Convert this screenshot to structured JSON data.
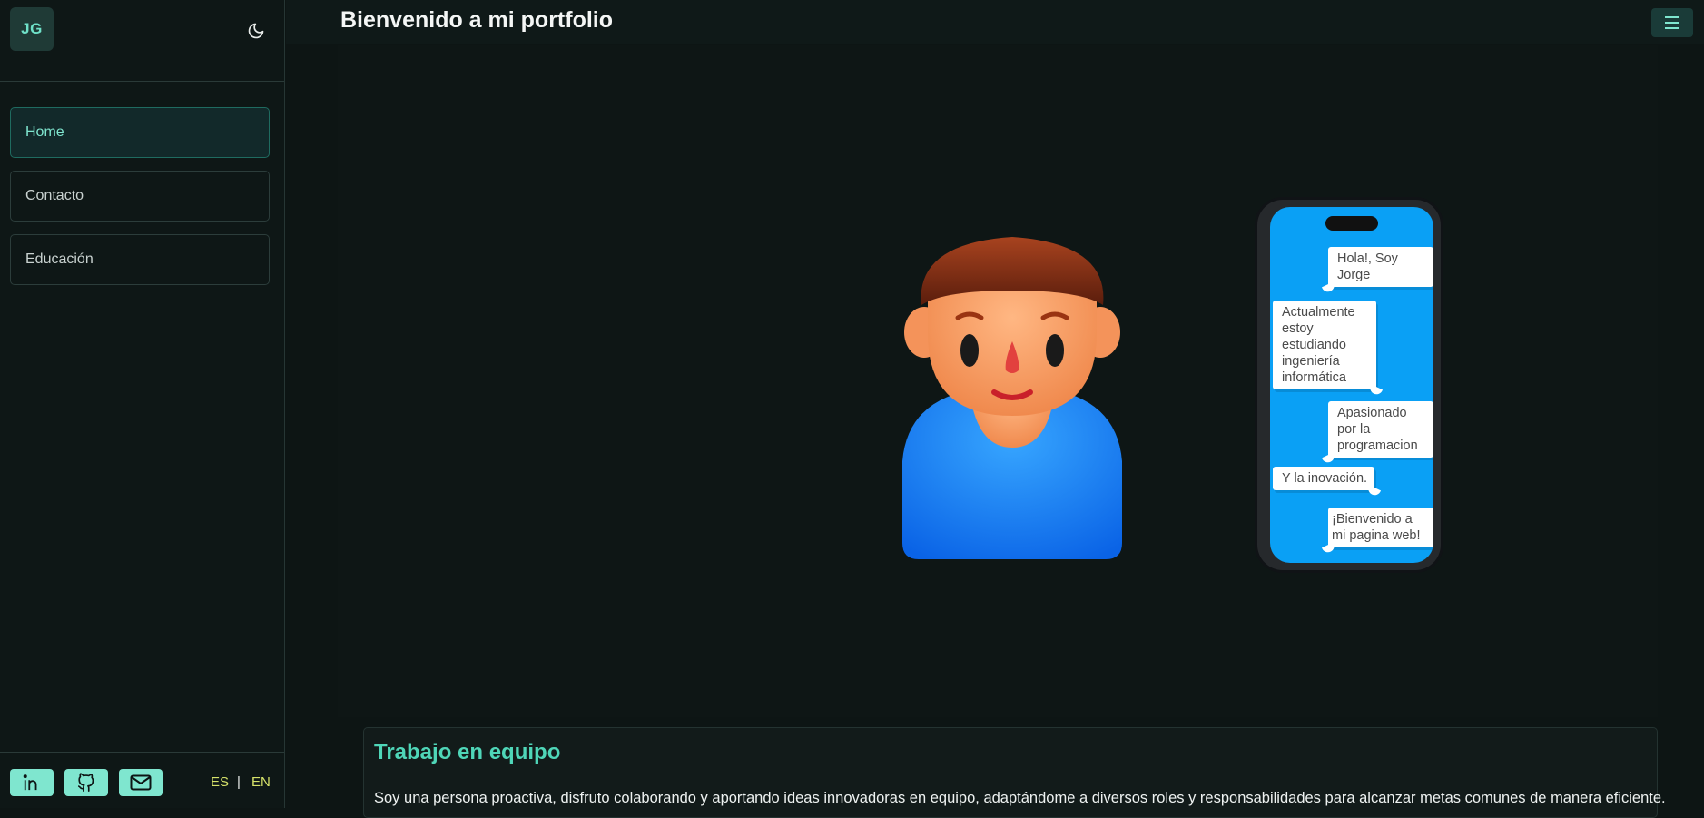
{
  "sidebar": {
    "logo": "JG",
    "nav": [
      {
        "label": "Home",
        "active": true
      },
      {
        "label": "Contacto",
        "active": false
      },
      {
        "label": "Educación",
        "active": false
      }
    ],
    "social": [
      "linkedin-icon",
      "github-icon",
      "mail-icon"
    ],
    "lang": {
      "es": "ES",
      "sep": "|",
      "en": "EN"
    }
  },
  "header": {
    "title": "Bienvenido a mi portfolio"
  },
  "phone": {
    "messages": [
      "Hola!, Soy Jorge",
      "Actualmente estoy estudiando ingeniería informática",
      "Apasionado por la programacion",
      "Y la inovación.",
      "¡Bienvenido a mi pagina web!"
    ]
  },
  "card": {
    "title": "Trabajo en equipo",
    "text": "Soy una persona proactiva, disfruto colaborando y aportando ideas innovadoras en equipo, adaptándome a diversos roles y responsabilidades para alcanzar metas comunes de manera eficiente."
  },
  "colors": {
    "accent": "#7fe6cf",
    "heading_accent": "#4fd6b8",
    "lang": "#d6e26a",
    "background": "#0d1514"
  }
}
